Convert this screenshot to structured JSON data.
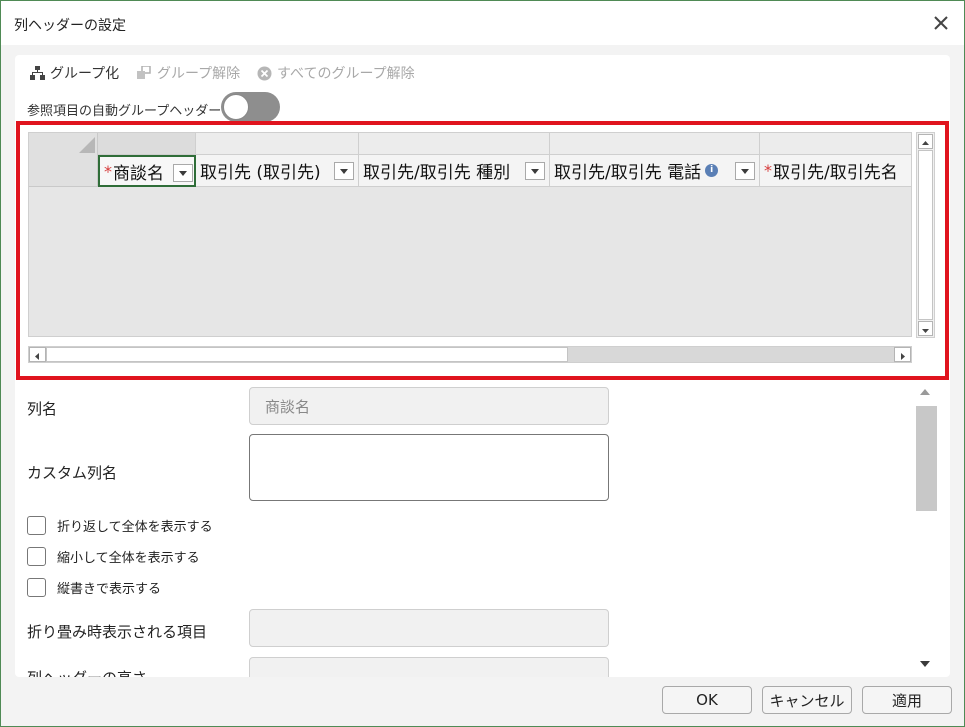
{
  "dialog": {
    "title": "列ヘッダーの設定"
  },
  "toolbar": {
    "group": "グループ化",
    "ungroup": "グループ解除",
    "ungroup_all": "すべてのグループ解除"
  },
  "toggle": {
    "label": "参照項目の自動グループヘッダー",
    "on": false
  },
  "grid": {
    "columns": [
      {
        "label": "商談名",
        "required": true,
        "info": false
      },
      {
        "label": "取引先 (取引先)",
        "required": false,
        "info": false
      },
      {
        "label": "取引先/取引先 種別",
        "required": false,
        "info": false
      },
      {
        "label": "取引先/取引先 電話",
        "required": false,
        "info": true
      },
      {
        "label": "取引先/取引先名",
        "required": true,
        "info": false
      }
    ],
    "required_mark": "*",
    "info_glyph": "i"
  },
  "form": {
    "column_name_label": "列名",
    "column_name_placeholder": "商談名",
    "custom_name_label": "カスタム列名",
    "checkboxes": [
      {
        "label": "折り返して全体を表示する",
        "checked": false
      },
      {
        "label": "縮小して全体を表示する",
        "checked": false
      },
      {
        "label": "縦書きで表示する",
        "checked": false
      }
    ],
    "collapsed_label": "折り畳み時表示される項目",
    "height_label": "列ヘッダーの高さ"
  },
  "buttons": {
    "ok": "OK",
    "cancel": "キャンセル",
    "apply": "適用"
  },
  "colors": {
    "highlight": "#e0141e",
    "selected_border": "#2f6d38",
    "required": "#d63a3a",
    "info": "#5a7fb5"
  }
}
